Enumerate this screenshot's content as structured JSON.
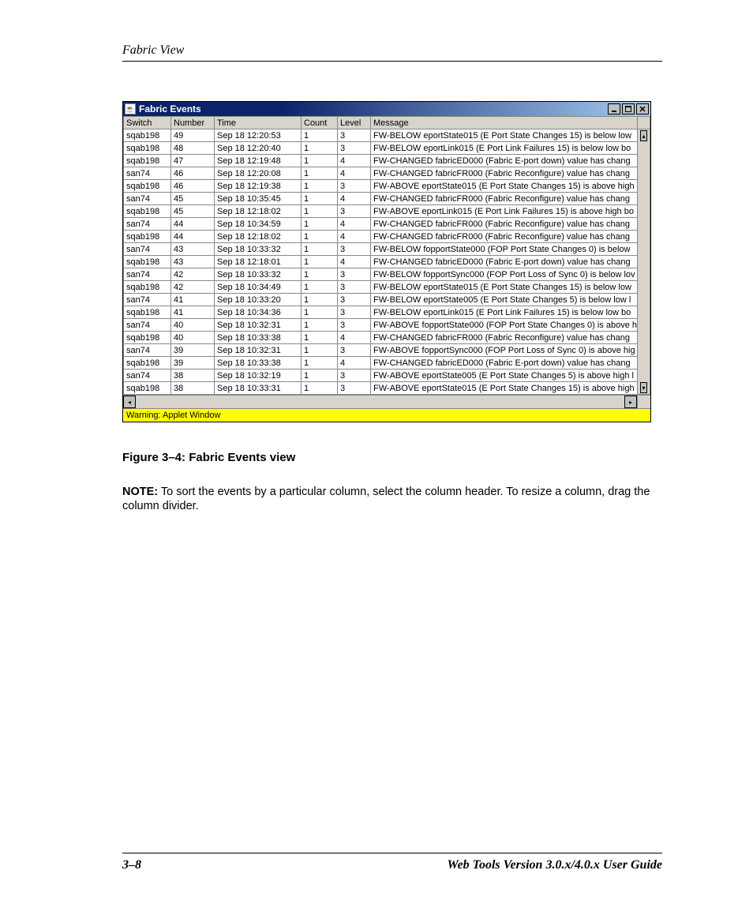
{
  "page": {
    "running_head": "Fabric View",
    "footer_left": "3–8",
    "footer_right": "Web Tools Version 3.0.x/4.0.x User Guide"
  },
  "window": {
    "title": "Fabric Events",
    "applet_warning": "Warning: Applet Window",
    "columns": {
      "switch": "Switch",
      "number": "Number",
      "time": "Time",
      "count": "Count",
      "level": "Level",
      "message": "Message"
    },
    "rows": [
      {
        "switch": "sqab198",
        "number": "49",
        "time": "Sep 18 12:20:53",
        "count": "1",
        "level": "3",
        "message": "FW-BELOW eportState015 (E Port State Changes 15) is below low"
      },
      {
        "switch": "sqab198",
        "number": "48",
        "time": "Sep 18 12:20:40",
        "count": "1",
        "level": "3",
        "message": "FW-BELOW eportLink015 (E Port Link Failures 15) is below low bo"
      },
      {
        "switch": "sqab198",
        "number": "47",
        "time": "Sep 18 12:19:48",
        "count": "1",
        "level": "4",
        "message": "FW-CHANGED fabricED000 (Fabric E-port down) value has chang"
      },
      {
        "switch": "san74",
        "number": "46",
        "time": "Sep 18 12:20:08",
        "count": "1",
        "level": "4",
        "message": "FW-CHANGED fabricFR000 (Fabric Reconfigure) value has chang"
      },
      {
        "switch": "sqab198",
        "number": "46",
        "time": "Sep 18 12:19:38",
        "count": "1",
        "level": "3",
        "message": "FW-ABOVE eportState015 (E Port State Changes 15) is above high"
      },
      {
        "switch": "san74",
        "number": "45",
        "time": "Sep 18 10:35:45",
        "count": "1",
        "level": "4",
        "message": "FW-CHANGED fabricFR000 (Fabric Reconfigure) value has chang"
      },
      {
        "switch": "sqab198",
        "number": "45",
        "time": "Sep 18 12:18:02",
        "count": "1",
        "level": "3",
        "message": "FW-ABOVE eportLink015 (E Port Link Failures 15) is above high bo"
      },
      {
        "switch": "san74",
        "number": "44",
        "time": "Sep 18 10:34:59",
        "count": "1",
        "level": "4",
        "message": "FW-CHANGED fabricFR000 (Fabric Reconfigure) value has chang"
      },
      {
        "switch": "sqab198",
        "number": "44",
        "time": "Sep 18 12:18:02",
        "count": "1",
        "level": "4",
        "message": "FW-CHANGED fabricFR000 (Fabric Reconfigure) value has chang"
      },
      {
        "switch": "san74",
        "number": "43",
        "time": "Sep 18 10:33:32",
        "count": "1",
        "level": "3",
        "message": "FW-BELOW fopportState000 (FOP Port State Changes 0) is below"
      },
      {
        "switch": "sqab198",
        "number": "43",
        "time": "Sep 18 12:18:01",
        "count": "1",
        "level": "4",
        "message": "FW-CHANGED fabricED000 (Fabric E-port down) value has chang"
      },
      {
        "switch": "san74",
        "number": "42",
        "time": "Sep 18 10:33:32",
        "count": "1",
        "level": "3",
        "message": "FW-BELOW fopportSync000 (FOP Port Loss of Sync 0) is below lov"
      },
      {
        "switch": "sqab198",
        "number": "42",
        "time": "Sep 18 10:34:49",
        "count": "1",
        "level": "3",
        "message": "FW-BELOW eportState015 (E Port State Changes 15) is below low"
      },
      {
        "switch": "san74",
        "number": "41",
        "time": "Sep 18 10:33:20",
        "count": "1",
        "level": "3",
        "message": "FW-BELOW eportState005 (E Port State Changes 5) is below low l"
      },
      {
        "switch": "sqab198",
        "number": "41",
        "time": "Sep 18 10:34:36",
        "count": "1",
        "level": "3",
        "message": "FW-BELOW eportLink015 (E Port Link Failures 15) is below low bo"
      },
      {
        "switch": "san74",
        "number": "40",
        "time": "Sep 18 10:32:31",
        "count": "1",
        "level": "3",
        "message": "FW-ABOVE fopportState000 (FOP Port State Changes 0) is above h"
      },
      {
        "switch": "sqab198",
        "number": "40",
        "time": "Sep 18 10:33:38",
        "count": "1",
        "level": "4",
        "message": "FW-CHANGED fabricFR000 (Fabric Reconfigure) value has chang"
      },
      {
        "switch": "san74",
        "number": "39",
        "time": "Sep 18 10:32:31",
        "count": "1",
        "level": "3",
        "message": "FW-ABOVE fopportSync000 (FOP Port Loss of Sync 0) is above hig"
      },
      {
        "switch": "sqab198",
        "number": "39",
        "time": "Sep 18 10:33:38",
        "count": "1",
        "level": "4",
        "message": "FW-CHANGED fabricED000 (Fabric E-port down) value has chang"
      },
      {
        "switch": "san74",
        "number": "38",
        "time": "Sep 18 10:32:19",
        "count": "1",
        "level": "3",
        "message": "FW-ABOVE eportState005 (E Port State Changes 5) is above high l"
      },
      {
        "switch": "sqab198",
        "number": "38",
        "time": "Sep 18 10:33:31",
        "count": "1",
        "level": "3",
        "message": "FW-ABOVE eportState015 (E Port State Changes 15) is above high"
      }
    ]
  },
  "caption": "Figure 3–4:  Fabric Events view",
  "note": {
    "label": "NOTE:",
    "text": "  To sort the events by a particular column, select the column header. To resize a column, drag the column divider."
  }
}
